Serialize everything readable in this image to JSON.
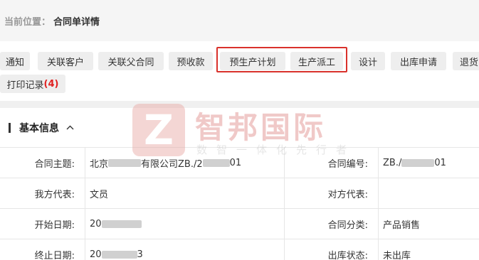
{
  "breadcrumb": {
    "label": "当前位置：",
    "current": "合同单详情"
  },
  "toolbar": {
    "buttons": [
      "通知",
      "关联客户",
      "关联父合同",
      "预收款",
      "预生产计划",
      "生产派工",
      "设计",
      "出库申请",
      "退货"
    ],
    "print_label": "打印记录",
    "print_count": "(4)"
  },
  "section": {
    "title": "基本信息",
    "toggle_icon": "chevron-up-icon"
  },
  "fields": {
    "contract_subject_label": "合同主题:",
    "contract_subject_value_prefix": "北京",
    "contract_subject_value_mid": "有限公司ZB./2",
    "contract_subject_value_suffix": "01",
    "contract_no_label": "合同编号:",
    "contract_no_value_prefix": "ZB./",
    "contract_no_value_suffix": "01",
    "our_rep_label": "我方代表:",
    "our_rep_value": "文员",
    "their_rep_label": "对方代表:",
    "their_rep_value": "",
    "start_date_label": "开始日期:",
    "start_date_value_prefix": "20",
    "contract_type_label": "合同分类:",
    "contract_type_value": "产品销售",
    "end_date_label": "终止日期:",
    "end_date_value_prefix": "20",
    "end_date_value_suffix": "3",
    "outbound_status_label": "出库状态:",
    "outbound_status_value": "未出库"
  },
  "watermark": {
    "logo_letter": "Z",
    "name": "智邦国际",
    "slogan": "数智一体化先行者"
  },
  "colors": {
    "highlight": "#d9312b",
    "count": "#e02020"
  }
}
